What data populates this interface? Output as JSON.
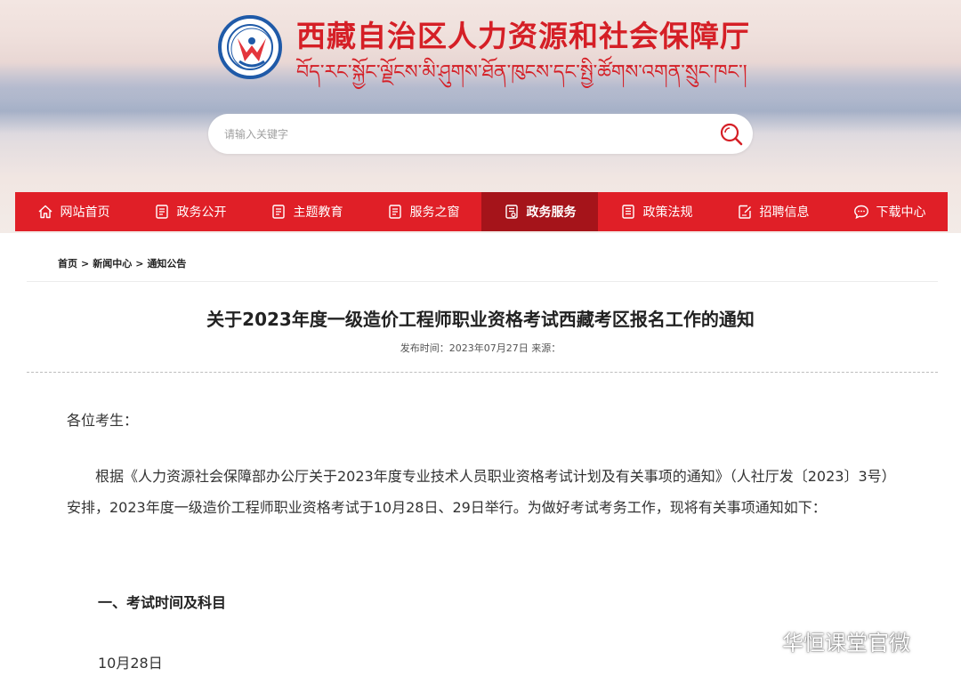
{
  "header": {
    "site_title": "西藏自治区人力资源和社会保障厅",
    "site_subtitle_tibetan": "བོད་རང་སྐྱོང་ལྗོངས་མི་ཤུགས་ཐོན་ཁུངས་དང་སྤྱི་ཚོགས་འགན་སྲུང་ཁང་།",
    "search_placeholder": "请输入关键字"
  },
  "nav": {
    "items": [
      {
        "label": "网站首页",
        "icon": "home-icon"
      },
      {
        "label": "政务公开",
        "icon": "document-icon"
      },
      {
        "label": "主题教育",
        "icon": "document-icon"
      },
      {
        "label": "服务之窗",
        "icon": "document-icon"
      },
      {
        "label": "政务服务",
        "icon": "document-list-icon",
        "active": true
      },
      {
        "label": "政策法规",
        "icon": "document-list-icon"
      },
      {
        "label": "招聘信息",
        "icon": "edit-icon"
      },
      {
        "label": "下载中心",
        "icon": "chat-icon"
      }
    ]
  },
  "breadcrumb": {
    "items": [
      "首页",
      "新闻中心",
      "通知公告"
    ],
    "separator": ">"
  },
  "article": {
    "title": "关于2023年度一级造价工程师职业资格考试西藏考区报名工作的通知",
    "meta": "发布时间：2023年07月27日 来源：",
    "greeting": "各位考生：",
    "paragraph1": "根据《人力资源社会保障部办公厅关于2023年度专业技术人员职业资格考试计划及有关事项的通知》（人社厅发〔2023〕3号）安排，2023年度一级造价工程师职业资格考试于10月28日、29日举行。为做好考试考务工作，现将有关事项通知如下：",
    "section1_heading": "一、考试时间及科目",
    "date1": "10月28日"
  },
  "watermark": {
    "text": "华恒课堂官微"
  },
  "colors": {
    "brand_red": "#e01f27",
    "active_red": "#a5141a",
    "title_red": "#d51f26"
  }
}
